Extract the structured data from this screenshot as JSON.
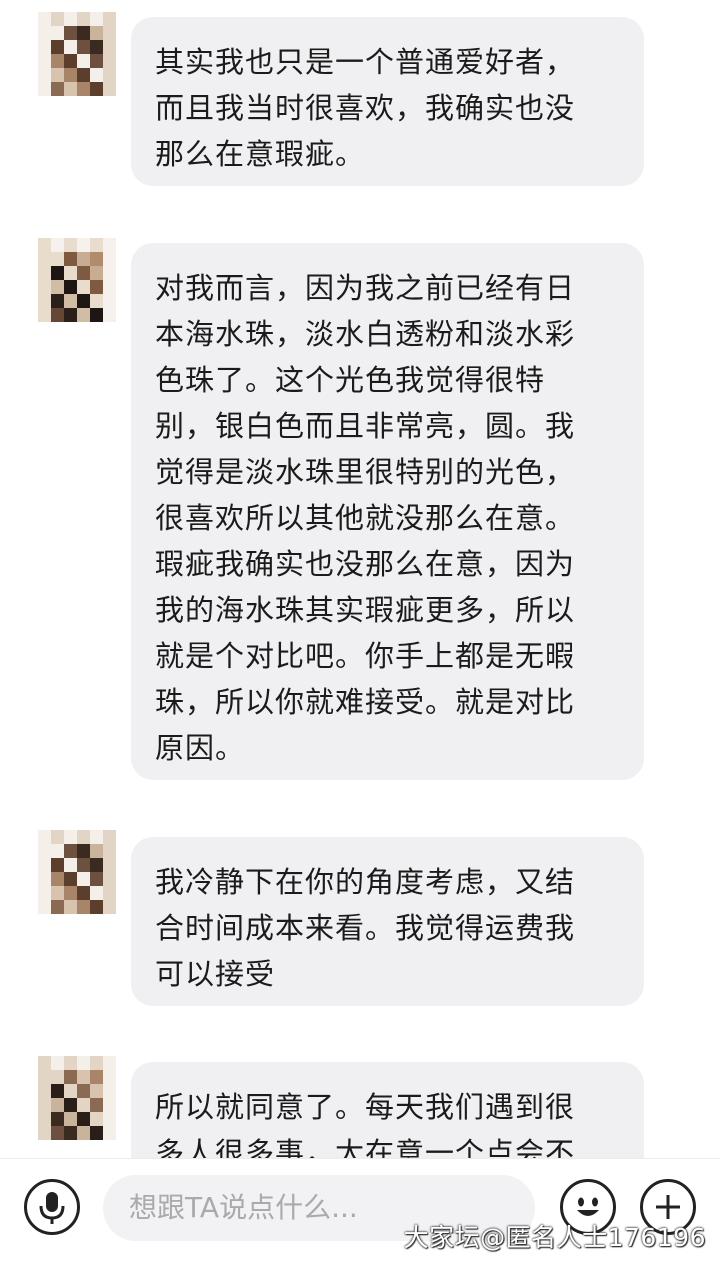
{
  "messages": [
    {
      "lines": [
        "其实我也只是一个普通爱好者，",
        "而且我当时很喜欢，我确实也没",
        "那么在意瑕疵。"
      ]
    },
    {
      "lines": [
        "对我而言，因为我之前已经有日",
        "本海水珠，淡水白透粉和淡水彩",
        "色珠了。这个光色我觉得很特",
        "别，银白色而且非常亮，圆。我",
        "觉得是淡水珠里很特别的光色，",
        "很喜欢所以其他就没那么在意。",
        "瑕疵我确实也没那么在意，因为",
        "我的海水珠其实瑕疵更多，所以",
        "就是个对比吧。你手上都是无暇",
        "珠，所以你就难接受。就是对比",
        "原因。"
      ]
    },
    {
      "lines": [
        "我冷静下在你的角度考虑，又结",
        "合时间成本来看。我觉得运费我",
        "可以接受"
      ]
    },
    {
      "lines": [
        "所以就同意了。每天我们遇到很",
        "多人很多事，太在意一个点会不"
      ]
    }
  ],
  "input": {
    "placeholder": "想跟TA说点什么..."
  },
  "icons": {
    "mic": "microphone-icon",
    "emoji": "emoji-icon",
    "plus": "plus-icon"
  },
  "watermark": "大家坛@匿名人士176196",
  "colors": {
    "bubble": "#f0f0f3",
    "text": "#1b1b1b",
    "placeholder": "#a9a9ae"
  }
}
